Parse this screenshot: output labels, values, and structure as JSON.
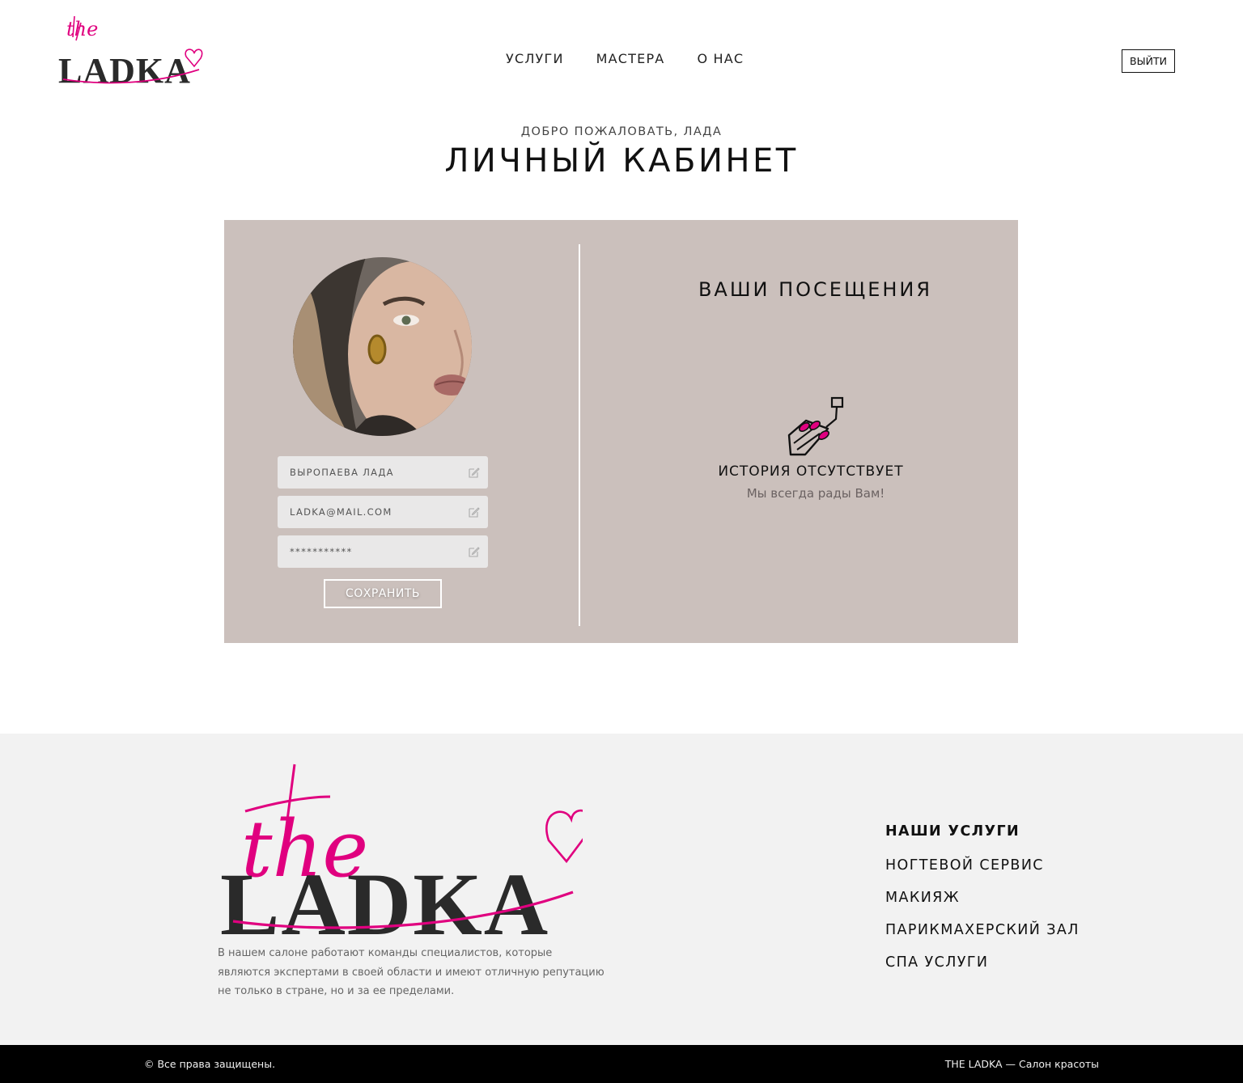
{
  "brand": {
    "logo_script": "the",
    "logo_word": "LADKA",
    "accent_color": "#e0007f"
  },
  "nav": {
    "items": [
      {
        "label": "УСЛУГИ"
      },
      {
        "label": "МАСТЕРА"
      },
      {
        "label": "О НАС"
      }
    ],
    "logout_label": "ВЫЙТИ"
  },
  "welcome": "ДОБРО ПОЖАЛОВАТЬ, ЛАДА",
  "page_title": "ЛИЧНЫЙ КАБИНЕТ",
  "profile": {
    "name_value": "ВЫРОПАЕВА ЛАДА",
    "email_value": "LADKA@MAIL.COM",
    "password_value": "***********",
    "save_label": "СОХРАНИТЬ",
    "edit_icon": "edit-icon"
  },
  "visits": {
    "title": "ВАШИ ПОСЕЩЕНИЯ",
    "empty_icon": "manicure-icon",
    "empty_title": "ИСТОРИЯ ОТСУТСТВУЕТ",
    "empty_subtitle": "Мы всегда рады Вам!"
  },
  "footer": {
    "description": "В нашем салоне работают команды специалистов, которые являются экспертами в своей области и имеют отличную репутацию не только в стране, но и за ее пределами.",
    "services_heading": "НАШИ УСЛУГИ",
    "services": [
      {
        "label": "НОГТЕВОЙ СЕРВИС"
      },
      {
        "label": "МАКИЯЖ"
      },
      {
        "label": "ПАРИКМАХЕРСКИЙ ЗАЛ"
      },
      {
        "label": "СПА УСЛУГИ"
      }
    ],
    "copyright": "© Все права защищены.",
    "tagline": "THE LADKA — Салон красоты"
  },
  "colors": {
    "card_bg": "#cbc0bc",
    "footer_bg": "#f2f2f2",
    "bottom_bar": "#000000",
    "accent": "#e0007f"
  }
}
